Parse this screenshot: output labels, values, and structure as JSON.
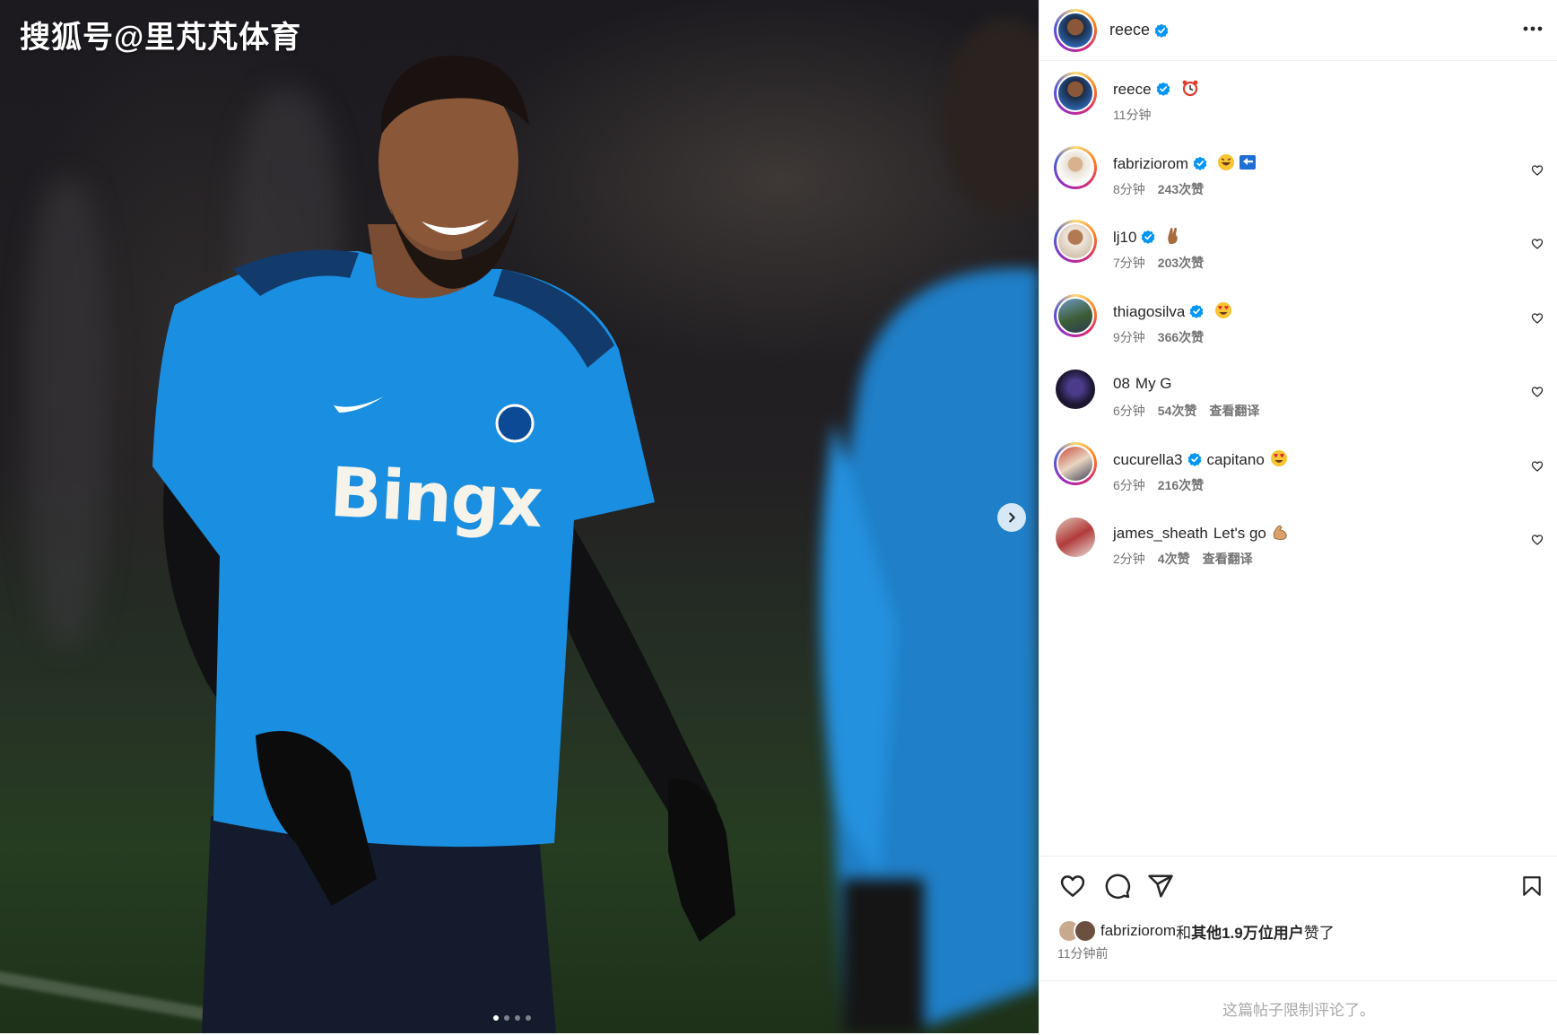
{
  "media": {
    "watermark": "搜狐号@里芃芃体育",
    "shirt_sponsor": "Bingx",
    "carousel": {
      "total": 4,
      "active": 1
    }
  },
  "post": {
    "author": "reece",
    "author_verified": true
  },
  "comments": [
    {
      "username": "reece",
      "verified": true,
      "text": "",
      "emoji": "alarm-clock-emoji",
      "time": "11分钟",
      "likes": "",
      "translate": "",
      "has_like_button": false
    },
    {
      "username": "fabriziorom",
      "verified": true,
      "text": "",
      "emoji": "laughing-back-emoji",
      "time": "8分钟",
      "likes": "243次赞",
      "translate": "",
      "has_like_button": true
    },
    {
      "username": "lj10",
      "verified": true,
      "text": "",
      "emoji": "crossed-fingers-emoji",
      "time": "7分钟",
      "likes": "203次赞",
      "translate": "",
      "has_like_button": true
    },
    {
      "username": "thiagosilva",
      "verified": true,
      "text": "",
      "emoji": "heart-eyes-emoji",
      "time": "9分钟",
      "likes": "366次赞",
      "translate": "",
      "has_like_button": true
    },
    {
      "username": "08",
      "verified": false,
      "text": "My G",
      "emoji": "",
      "time": "6分钟",
      "likes": "54次赞",
      "translate": "查看翻译",
      "has_like_button": true
    },
    {
      "username": "cucurella3",
      "verified": true,
      "text": "capitano",
      "emoji": "heart-eyes-emoji",
      "time": "6分钟",
      "likes": "216次赞",
      "translate": "",
      "has_like_button": true
    },
    {
      "username": "james_sheath",
      "verified": false,
      "text": "Let's go",
      "emoji": "flexed-biceps-emoji",
      "time": "2分钟",
      "likes": "4次赞",
      "translate": "查看翻译",
      "has_like_button": true
    }
  ],
  "likes": {
    "first_user": "fabriziorom",
    "connector": "和",
    "others": "其他1.9万位用户",
    "suffix": "赞了"
  },
  "post_time": "11分钟前",
  "comments_limited": "这篇帖子限制评论了。",
  "colors": {
    "verified_blue": "#0095f6",
    "story_ring": "#d62976",
    "secondary_text": "#737373"
  }
}
